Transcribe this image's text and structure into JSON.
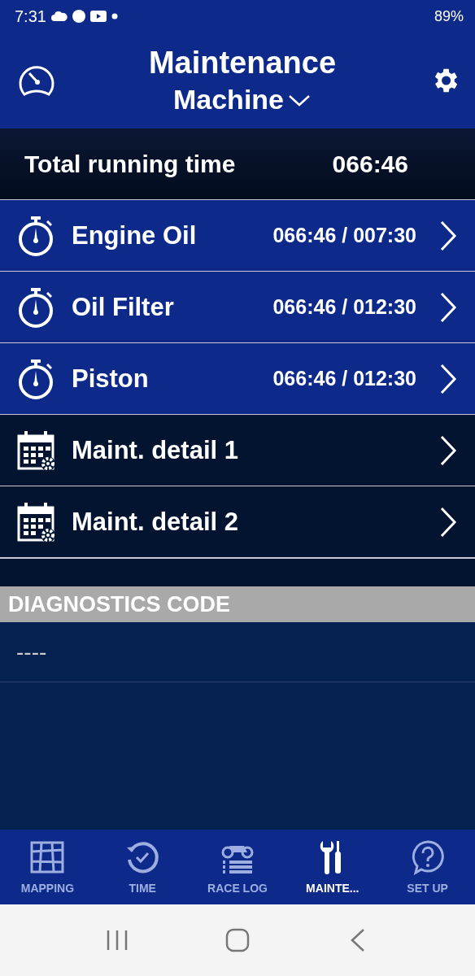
{
  "status_bar": {
    "time": "7:31",
    "battery": "89%"
  },
  "header": {
    "title": "Maintenance",
    "subtitle": "Machine"
  },
  "total": {
    "label": "Total running time",
    "value": "066:46"
  },
  "items": [
    {
      "kind": "timer",
      "label": "Engine Oil",
      "reading": "066:46 / 007:30"
    },
    {
      "kind": "timer",
      "label": "Oil Filter",
      "reading": "066:46 / 012:30"
    },
    {
      "kind": "timer",
      "label": "Piston",
      "reading": "066:46 / 012:30"
    },
    {
      "kind": "detail",
      "label": "Maint. detail 1"
    },
    {
      "kind": "detail",
      "label": "Maint. detail 2"
    }
  ],
  "diagnostics": {
    "title": "DIAGNOSTICS CODE",
    "value": "----"
  },
  "tabs": [
    {
      "kind": "map",
      "label": "MAPPING",
      "selected": false
    },
    {
      "kind": "time",
      "label": "TIME",
      "selected": false
    },
    {
      "kind": "log",
      "label": "RACE LOG",
      "selected": false
    },
    {
      "kind": "tools",
      "label": "MAINTE...",
      "selected": true
    },
    {
      "kind": "help",
      "label": "SET UP",
      "selected": false
    }
  ]
}
